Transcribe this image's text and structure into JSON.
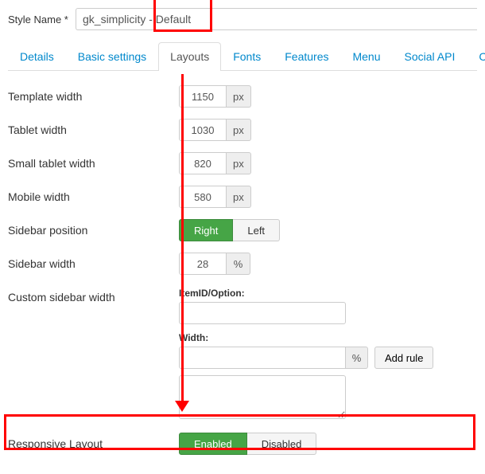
{
  "style_name_label": "Style Name *",
  "style_name_value": "gk_simplicity - Default",
  "tabs": [
    {
      "label": "Details"
    },
    {
      "label": "Basic settings"
    },
    {
      "label": "Layouts"
    },
    {
      "label": "Fonts"
    },
    {
      "label": "Features"
    },
    {
      "label": "Menu"
    },
    {
      "label": "Social API"
    },
    {
      "label": "Cookie"
    }
  ],
  "fields": {
    "template_width": {
      "label": "Template width",
      "value": "1150",
      "unit": "px"
    },
    "tablet_width": {
      "label": "Tablet width",
      "value": "1030",
      "unit": "px"
    },
    "small_tablet_width": {
      "label": "Small tablet width",
      "value": "820",
      "unit": "px"
    },
    "mobile_width": {
      "label": "Mobile width",
      "value": "580",
      "unit": "px"
    },
    "sidebar_position": {
      "label": "Sidebar position",
      "opt_a": "Right",
      "opt_b": "Left"
    },
    "sidebar_width": {
      "label": "Sidebar width",
      "value": "28",
      "unit": "%"
    },
    "custom_sidebar": {
      "label": "Custom sidebar width",
      "itemid_label": "ItemID/Option:",
      "width_label": "Width:",
      "width_unit": "%",
      "add_rule": "Add rule"
    },
    "responsive": {
      "label": "Responsive Layout",
      "opt_a": "Enabled",
      "opt_b": "Disabled"
    }
  }
}
